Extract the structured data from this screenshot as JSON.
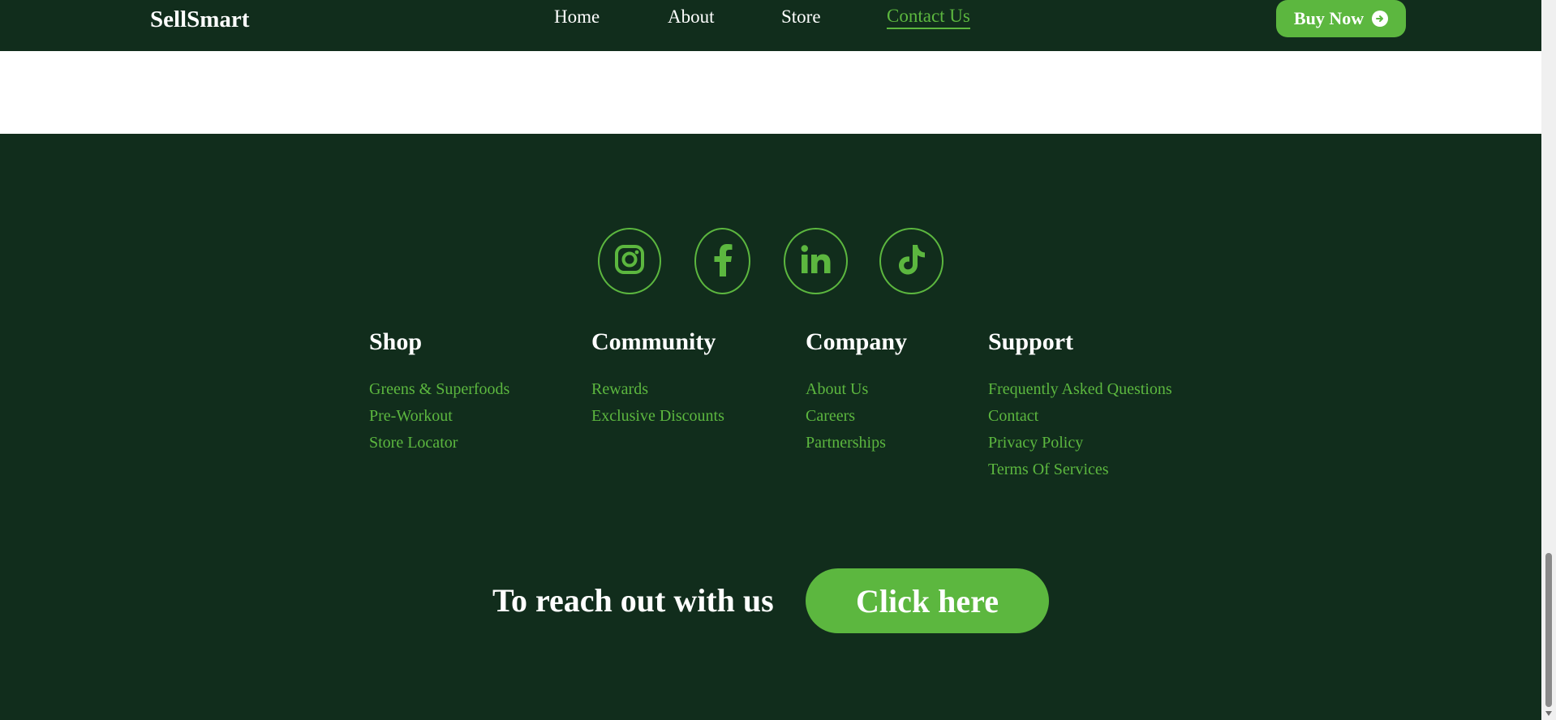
{
  "header": {
    "logo": "SellSmart",
    "nav": [
      {
        "label": "Home"
      },
      {
        "label": "About"
      },
      {
        "label": "Store"
      },
      {
        "label": "Contact Us",
        "active": true
      }
    ],
    "buy_button": "Buy Now"
  },
  "social": [
    {
      "icon": "instagram-icon"
    },
    {
      "icon": "facebook-icon"
    },
    {
      "icon": "linkedin-icon"
    },
    {
      "icon": "tiktok-icon"
    }
  ],
  "footer": {
    "columns": [
      {
        "title": "Shop",
        "links": [
          "Greens & Superfoods",
          "Pre-Workout",
          "Store Locator"
        ]
      },
      {
        "title": "Community",
        "links": [
          "Rewards",
          "Exclusive Discounts"
        ]
      },
      {
        "title": "Company",
        "links": [
          "About Us",
          "Careers",
          "Partnerships"
        ]
      },
      {
        "title": "Support",
        "links": [
          "Frequently Asked Questions",
          "Contact",
          "Privacy Policy",
          "Terms Of Services"
        ]
      }
    ]
  },
  "cta": {
    "text": "To reach out with us",
    "button": "Click here"
  },
  "colors": {
    "background": "#112d1c",
    "accent": "#5cb73f",
    "text": "#ffffff"
  }
}
